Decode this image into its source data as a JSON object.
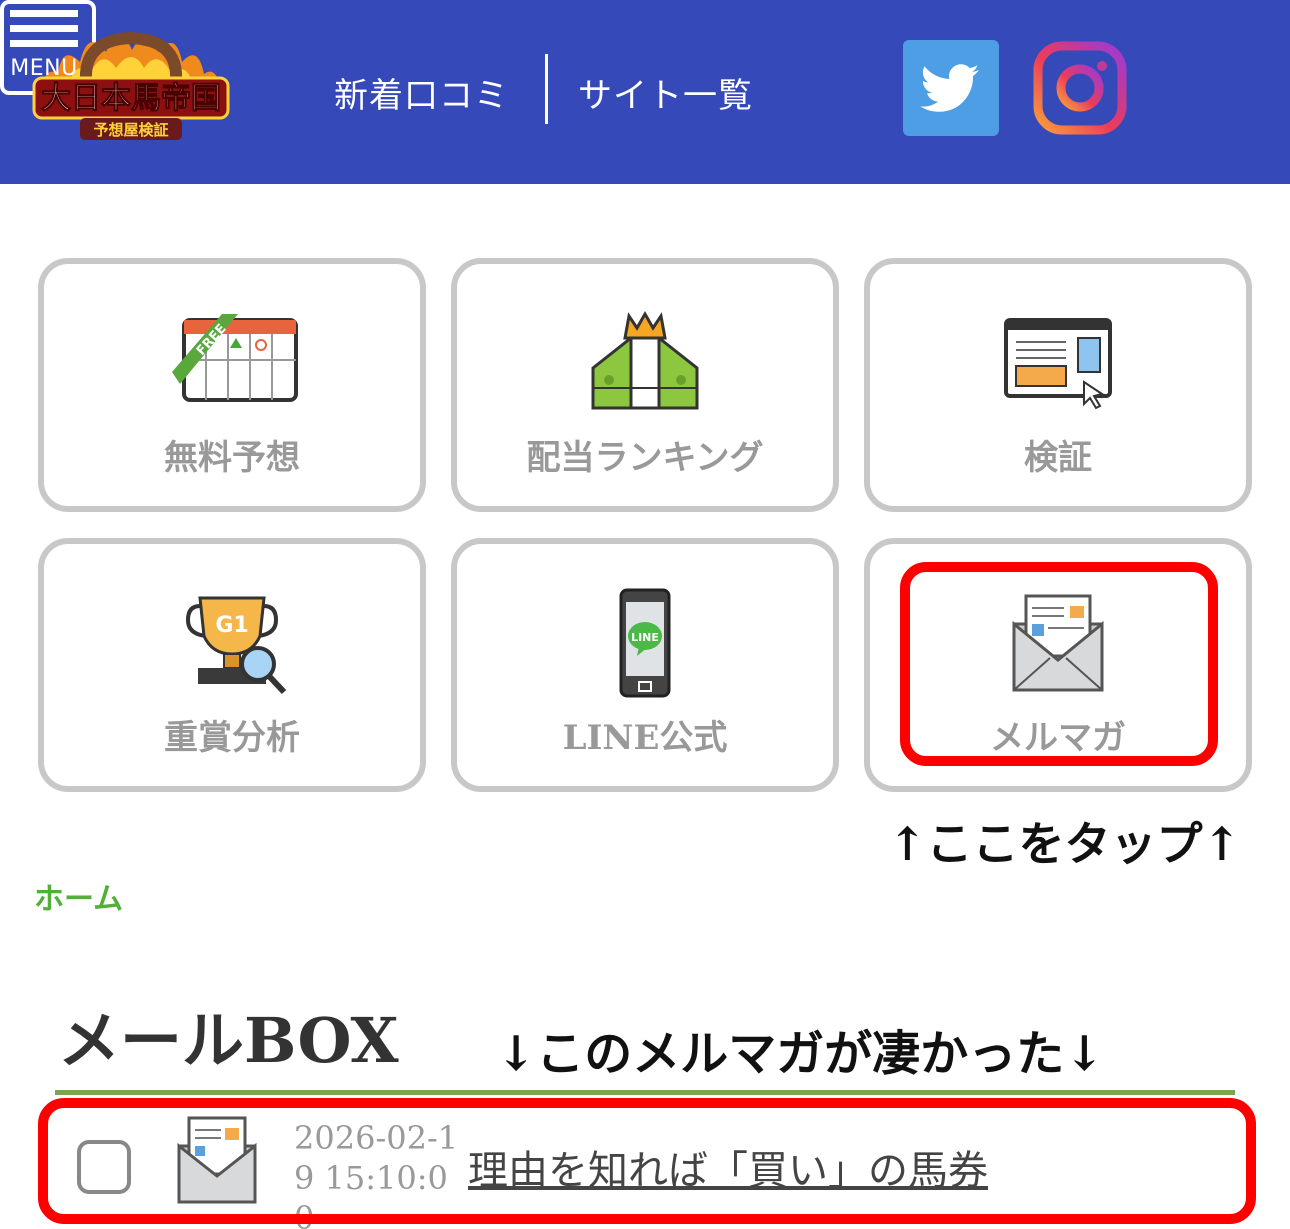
{
  "header": {
    "logo_text": "大日本馬帝国",
    "logo_subtext": "予想屋検証",
    "nav": [
      {
        "label": "新着口コミ"
      },
      {
        "label": "サイト一覧"
      }
    ],
    "social": [
      {
        "icon": "twitter-icon",
        "color": "#4e9ee6"
      },
      {
        "icon": "instagram-icon"
      }
    ],
    "menu_label": "MENU",
    "background": "#3649b8"
  },
  "categories": [
    {
      "label": "無料予想",
      "icon": "free-calendar-icon"
    },
    {
      "label": "配当ランキング",
      "icon": "money-crown-icon"
    },
    {
      "label": "検証",
      "icon": "browser-window-icon"
    },
    {
      "label": "重賞分析",
      "icon": "g1-trophy-magnifier-icon"
    },
    {
      "label": "LINE公式",
      "icon": "line-phone-icon"
    },
    {
      "label": "メルマガ",
      "icon": "mail-envelope-icon"
    }
  ],
  "annotation_tap": "↑ここをタップ↑",
  "breadcrumb": "ホーム",
  "mailbox": {
    "title": "メールBOX",
    "annotation": "↓このメルマガが凄かった↓",
    "items": [
      {
        "date": "2026-02-19 15:10:00",
        "subject": "理由を知れば「買い」の馬券"
      }
    ]
  },
  "colors": {
    "highlight": "#ff0000",
    "breadcrumb": "#52b038",
    "card_border": "#c8c8c8",
    "card_text": "#999999",
    "rule": "#7aa650"
  }
}
